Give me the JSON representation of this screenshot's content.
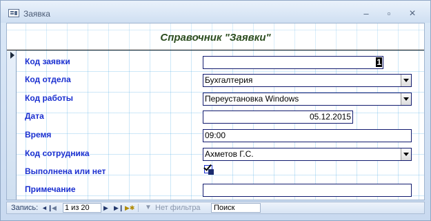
{
  "window": {
    "title": "Заявка"
  },
  "form": {
    "header": "Справочник \"Заявки\"",
    "fields": [
      {
        "label": "Код заявки",
        "value": "1"
      },
      {
        "label": "Код отдела",
        "value": "Бухгалтерия"
      },
      {
        "label": "Код работы",
        "value": "Переустановка Windows"
      },
      {
        "label": "Дата",
        "value": "05.12.2015"
      },
      {
        "label": "Время",
        "value": "09:00"
      },
      {
        "label": "Код сотрудника",
        "value": "Ахметов Г.С."
      },
      {
        "label": "Выполнена или нет",
        "value": true
      },
      {
        "label": "Примечание",
        "value": ""
      }
    ]
  },
  "navigation": {
    "record_label": "Запись:",
    "record_position": "1 из 20",
    "filter_label": "Нет фильтра",
    "search_label": "Поиск"
  },
  "icons": {
    "app": "form-icon",
    "first": "first-record-icon",
    "prev": "previous-record-icon",
    "next": "next-record-icon",
    "last": "last-record-icon",
    "new": "new-record-icon",
    "filter": "filter-icon"
  }
}
